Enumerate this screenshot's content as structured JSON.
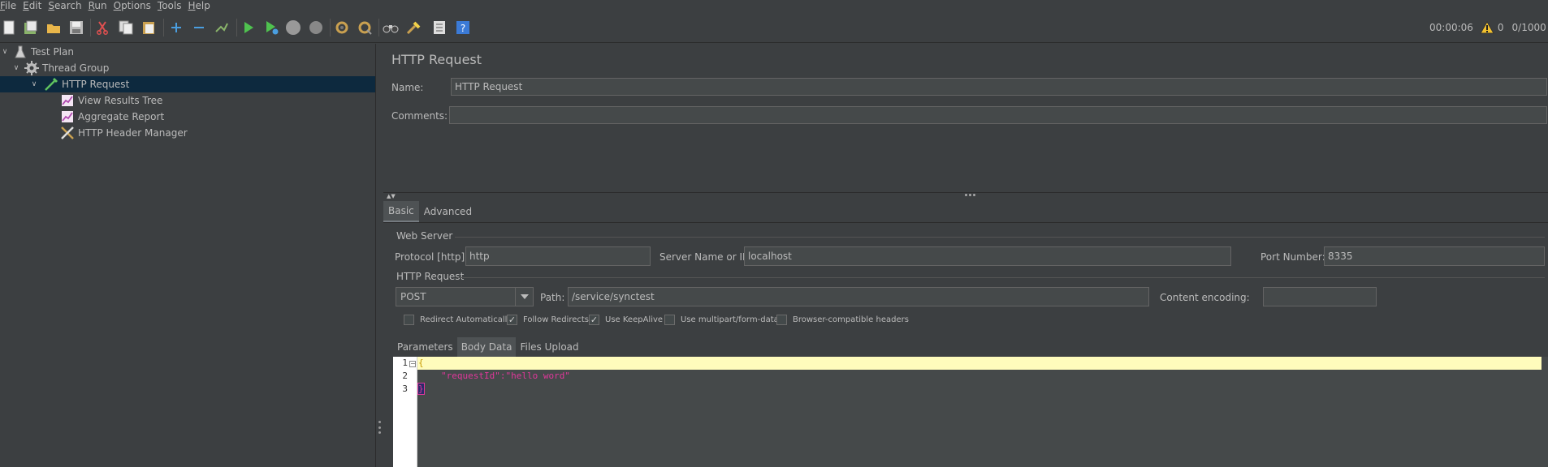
{
  "menu": [
    {
      "label": "File",
      "u": "F",
      "rest": "ile"
    },
    {
      "label": "Edit",
      "u": "E",
      "rest": "dit"
    },
    {
      "label": "Search",
      "u": "S",
      "rest": "earch"
    },
    {
      "label": "Run",
      "u": "R",
      "rest": "un"
    },
    {
      "label": "Options",
      "u": "O",
      "rest": "ptions"
    },
    {
      "label": "Tools",
      "u": "T",
      "rest": "ools"
    },
    {
      "label": "Help",
      "u": "H",
      "rest": "elp"
    }
  ],
  "status": {
    "elapsed": "00:00:06",
    "warnings": "0",
    "threads": "0/1000"
  },
  "tree": [
    {
      "label": "Test Plan",
      "icon": "test-plan-icon"
    },
    {
      "label": "Thread Group",
      "icon": "gear-icon"
    },
    {
      "label": "HTTP Request",
      "icon": "pipette-icon",
      "selected": true
    },
    {
      "label": "View Results Tree",
      "icon": "graph-icon"
    },
    {
      "label": "Aggregate Report",
      "icon": "graph-icon"
    },
    {
      "label": "HTTP Header Manager",
      "icon": "tools-icon"
    }
  ],
  "panel": {
    "title": "HTTP Request",
    "name_label": "Name:",
    "name_value": "HTTP Request",
    "comments_label": "Comments:",
    "comments_value": ""
  },
  "tabs": [
    "Basic",
    "Advanced"
  ],
  "web_server": {
    "group_title": "Web Server",
    "protocol_label": "Protocol [http]:",
    "protocol_value": "http",
    "server_label": "Server Name or IP:",
    "server_value": "localhost",
    "port_label": "Port Number:",
    "port_value": "8335"
  },
  "http_request": {
    "group_title": "HTTP Request",
    "method": "POST",
    "path_label": "Path:",
    "path_value": "/service/synctest",
    "encoding_label": "Content encoding:",
    "encoding_value": ""
  },
  "checkboxes": [
    {
      "label": "Redirect Automatically",
      "checked": false
    },
    {
      "label": "Follow Redirects",
      "checked": true
    },
    {
      "label": "Use KeepAlive",
      "checked": true
    },
    {
      "label": "Use multipart/form-data",
      "checked": false
    },
    {
      "label": "Browser-compatible headers",
      "checked": false
    }
  ],
  "subtabs": [
    "Parameters",
    "Body Data",
    "Files Upload"
  ],
  "body": {
    "line_numbers": [
      "1",
      "2",
      "3"
    ],
    "line1": "{",
    "line2": "\"requestId\":\"hello word\"",
    "line3": "}"
  },
  "colors": {
    "accent_key": "#e0379a",
    "brace": "#c79a00"
  }
}
